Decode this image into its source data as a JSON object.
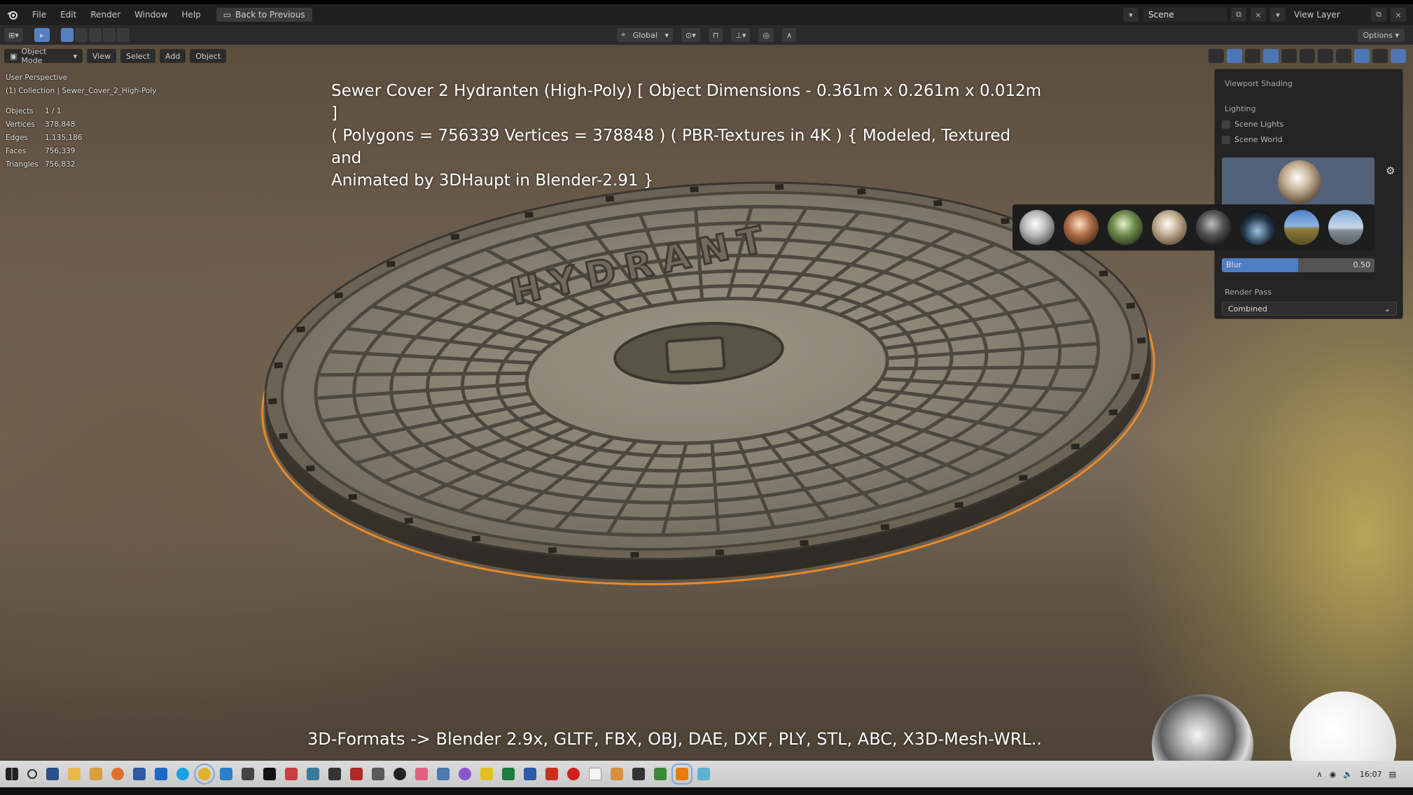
{
  "menubar": {
    "items": [
      "File",
      "Edit",
      "Render",
      "Window",
      "Help"
    ],
    "back_button": "Back to Previous",
    "scene": "Scene",
    "view_layer": "View Layer"
  },
  "header": {
    "transform_orientation": "Global",
    "options": "Options"
  },
  "viewport_header": {
    "mode": "Object Mode",
    "menus": [
      "View",
      "Select",
      "Add",
      "Object"
    ]
  },
  "overlay": {
    "perspective": "User Perspective",
    "collection": "(1) Collection | Sewer_Cover_2_High-Poly",
    "stats": [
      {
        "label": "Objects",
        "value": "1 / 1"
      },
      {
        "label": "Vertices",
        "value": "378,848"
      },
      {
        "label": "Edges",
        "value": "1,135,186"
      },
      {
        "label": "Faces",
        "value": "756,339"
      },
      {
        "label": "Triangles",
        "value": "756,832"
      }
    ]
  },
  "caption": {
    "line1": "Sewer Cover 2 Hydranten (High-Poly) [ Object Dimensions -  0.361m x 0.261m x 0.012m ]",
    "line2": "( Polygons = 756339 Vertices = 378848 ) ( PBR-Textures in 4K ) { Modeled, Textured and",
    "line3": "Animated by 3DHaupt in Blender-2.91 }",
    "formats": "3D-Formats -> Blender 2.9x, GLTF, FBX, OBJ, DAE, DXF, PLY, STL, ABC, X3D-Mesh-WRL.."
  },
  "model": {
    "embossed_text": "HYDRANT"
  },
  "shading_panel": {
    "title": "Viewport Shading",
    "lighting": "Lighting",
    "scene_lights": "Scene Lights",
    "scene_world": "Scene World",
    "blur_label": "Blur",
    "blur_value": "0.50",
    "blur_fraction": 0.5,
    "render_pass_label": "Render Pass",
    "render_pass_value": "Combined",
    "hdri_selected_index": 4
  },
  "taskbar": {
    "clock": "16:07"
  },
  "colors": {
    "selection_outline": "#e8892a",
    "accent": "#4d76b7"
  }
}
